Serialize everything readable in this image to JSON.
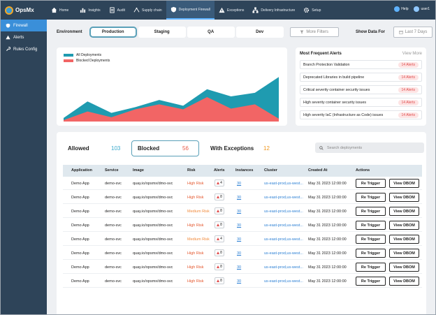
{
  "app": {
    "name": "OpsMx"
  },
  "nav": [
    {
      "label": "Home",
      "icon": "home-icon"
    },
    {
      "label": "Insights",
      "icon": "chart-icon"
    },
    {
      "label": "Audit",
      "icon": "audit-icon"
    },
    {
      "label": "Supply chain",
      "icon": "supply-chain-icon"
    },
    {
      "label": "Deployment Firewall",
      "icon": "shield-icon"
    },
    {
      "label": "Exceptions",
      "icon": "warning-icon"
    },
    {
      "label": "Delivery Infrastructure",
      "icon": "network-icon"
    },
    {
      "label": "Setup",
      "icon": "gear-icon"
    }
  ],
  "top_right": {
    "help": "Help",
    "user": "user1"
  },
  "sidebar": [
    {
      "label": "Firewall",
      "icon": "firewall-icon"
    },
    {
      "label": "Alerts",
      "icon": "alert-icon"
    },
    {
      "label": "Rules Config",
      "icon": "wrench-icon"
    }
  ],
  "filters": {
    "env_label": "Environment",
    "envs": [
      "Production",
      "Staging",
      "QA",
      "Dev"
    ],
    "more": "More Filters",
    "show_label": "Show Data For",
    "period": "Last 7 Days"
  },
  "chart_data": {
    "type": "area",
    "x": [
      1,
      2,
      3,
      4,
      5,
      6,
      7,
      8,
      9,
      10
    ],
    "series": [
      {
        "name": "All Deployments",
        "color": "#1f9bb0",
        "values": [
          5,
          28,
          12,
          20,
          30,
          22,
          45,
          35,
          40,
          62
        ]
      },
      {
        "name": "Blocked Deployments",
        "color": "#f26565",
        "values": [
          2,
          14,
          6,
          17,
          24,
          17,
          34,
          18,
          24,
          4
        ]
      }
    ],
    "ylim": [
      0,
      70
    ]
  },
  "alerts": {
    "title": "Most Frequent Alerts",
    "more": "View More",
    "items": [
      {
        "label": "Branch Protection Validation",
        "badge": "14 Alerts"
      },
      {
        "label": "Deprecated Libraries in build pipeline",
        "badge": "14 Alerts"
      },
      {
        "label": "Critical severity container security issues",
        "badge": "14 Alerts"
      },
      {
        "label": "High severity container security issues",
        "badge": "14 Alerts"
      },
      {
        "label": "High severity IaC (Infrastructure as Code) issues",
        "badge": "14 Alerts"
      }
    ]
  },
  "status": {
    "allowed": {
      "label": "Allowed",
      "count": "103",
      "color": "#3aa9cc"
    },
    "blocked": {
      "label": "Blocked",
      "count": "56",
      "color": "#e85c4a"
    },
    "exceptions": {
      "label": "With Exceptions",
      "count": "12",
      "color": "#f0961c"
    },
    "search_placeholder": "Search deployments"
  },
  "table": {
    "headers": [
      "Application",
      "Service",
      "Image",
      "Risk",
      "Alerts",
      "Instances",
      "Cluster",
      "Created At",
      "Actions"
    ],
    "rows": [
      {
        "app": "Demo App",
        "service": "demo-svc",
        "image": "quay.io/opsmx/dmo-svc",
        "risk": "High Risk",
        "alerts": "4",
        "instances": "30",
        "cluster": "us-east-prod,us-west...",
        "created": "May 31 2023 12:00:00",
        "btn1": "Re Trigger",
        "btn2": "View DBOM"
      },
      {
        "app": "Demo App",
        "service": "demo-svc",
        "image": "quay.io/opsmx/dmo-svc",
        "risk": "High Risk",
        "alerts": "8",
        "instances": "30",
        "cluster": "us-east-prod,us-west...",
        "created": "May 31 2023 12:00:00",
        "btn1": "Re Trigger",
        "btn2": "View DBOM"
      },
      {
        "app": "Demo App",
        "service": "demo-svc",
        "image": "quay.io/opsmx/dmo-svc",
        "risk": "Medium Risk",
        "alerts": "8",
        "instances": "30",
        "cluster": "us-east-prod,us-west...",
        "created": "May 31 2023 12:00:00",
        "btn1": "Re Trigger",
        "btn2": "View DBOM"
      },
      {
        "app": "Demo App",
        "service": "demo-svc",
        "image": "quay.io/opsmx/dmo-svc",
        "risk": "High Risk",
        "alerts": "8",
        "instances": "30",
        "cluster": "us-east-prod,us-west...",
        "created": "May 31 2023 12:00:00",
        "btn1": "Re Trigger",
        "btn2": "View DBOM"
      },
      {
        "app": "Demo App",
        "service": "demo-svc",
        "image": "quay.io/opsmx/dmo-svc",
        "risk": "Medium Risk",
        "alerts": "4",
        "instances": "30",
        "cluster": "us-east-prod,us-west...",
        "created": "May 31 2023 12:00:00",
        "btn1": "Re Trigger",
        "btn2": "View DBOM"
      },
      {
        "app": "Demo App",
        "service": "demo-svc",
        "image": "quay.io/opsmx/dmo-svc",
        "risk": "High Risk",
        "alerts": "8",
        "instances": "30",
        "cluster": "us-east-prod,us-west...",
        "created": "May 31 2023 12:00:00",
        "btn1": "Re Trigger",
        "btn2": "View DBOM"
      },
      {
        "app": "Demo App",
        "service": "demo-svc",
        "image": "quay.io/opsmx/dmo-svc",
        "risk": "High Risk",
        "alerts": "8",
        "instances": "30",
        "cluster": "us-east-prod,us-west...",
        "created": "May 31 2023 12:00:00",
        "btn1": "Re Trigger",
        "btn2": "View DBOM"
      },
      {
        "app": "Demo App",
        "service": "demo-svc",
        "image": "quay.io/opsmx/dmo-svc",
        "risk": "High Risk",
        "alerts": "8",
        "instances": "30",
        "cluster": "us-east-prod,us-west...",
        "created": "May 31 2023 12:00:00",
        "btn1": "Re Trigger",
        "btn2": "View DBOM"
      }
    ]
  }
}
